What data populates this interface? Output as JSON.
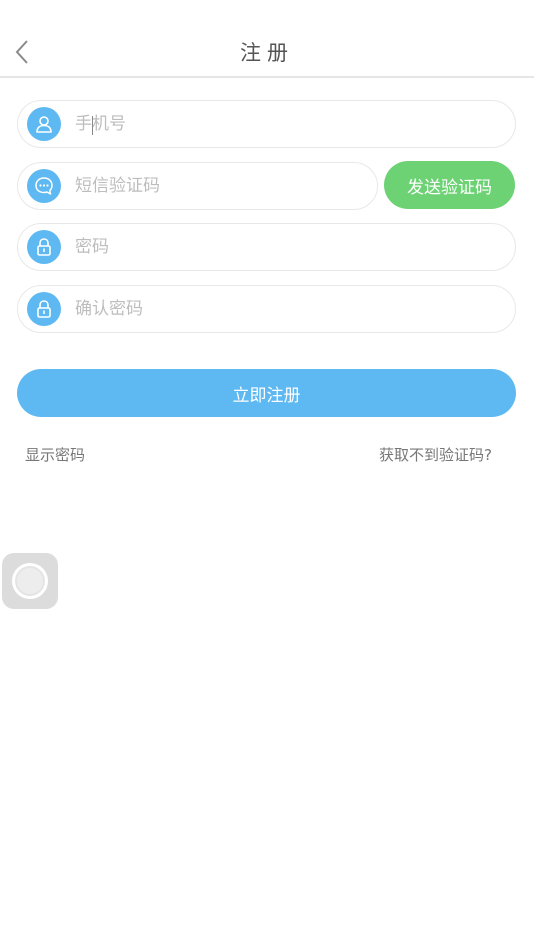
{
  "header": {
    "title": "注册",
    "back_icon": "chevron-left-icon"
  },
  "form": {
    "phone": {
      "placeholder": "手机号",
      "value": "",
      "icon": "user-icon"
    },
    "sms_code": {
      "placeholder": "短信验证码",
      "value": "",
      "icon": "message-icon"
    },
    "password": {
      "placeholder": "密码",
      "value": "",
      "icon": "lock-icon"
    },
    "confirm_password": {
      "placeholder": "确认密码",
      "value": "",
      "icon": "lock-icon"
    },
    "send_code_label": "发送验证码",
    "register_label": "立即注册",
    "show_password_label": "显示密码",
    "no_code_label": "获取不到验证码?"
  },
  "colors": {
    "primary_blue": "#5eb9f2",
    "send_green": "#6cd274",
    "text_gray": "#777777",
    "placeholder_gray": "#bdbdbd"
  },
  "floating": {
    "icon": "assistive-touch-icon"
  }
}
